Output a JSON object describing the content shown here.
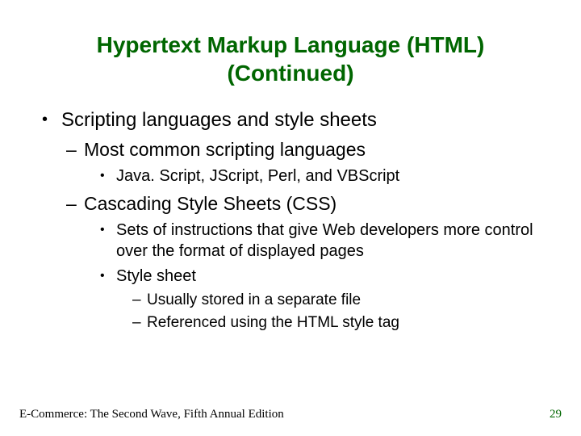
{
  "title_line1": "Hypertext Markup Language (HTML)",
  "title_line2": "(Continued)",
  "b1": "Scripting languages and style sheets",
  "b1_1": "Most common scripting languages",
  "b1_1_1": "Java. Script, JScript, Perl, and VBScript",
  "b1_2": "Cascading Style Sheets (CSS)",
  "b1_2_1": "Sets of instructions that give Web developers more control over the format of displayed pages",
  "b1_2_2": "Style sheet",
  "b1_2_2_1": "Usually stored in a separate file",
  "b1_2_2_2": "Referenced using the HTML style tag",
  "footer_left": "E-Commerce: The Second Wave, Fifth Annual Edition",
  "footer_right": "29"
}
